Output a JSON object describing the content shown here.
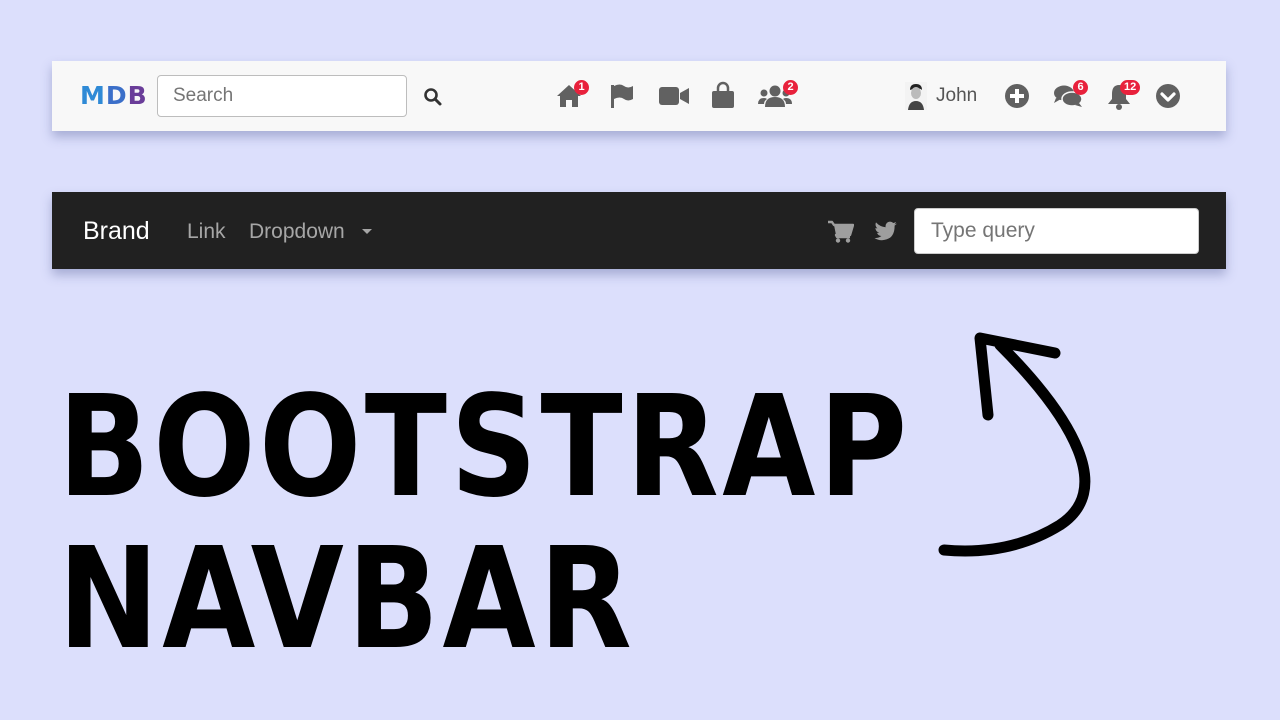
{
  "light_navbar": {
    "logo": {
      "m": "M",
      "d": "D",
      "b": "B"
    },
    "search": {
      "placeholder": "Search",
      "value": ""
    },
    "icons": [
      {
        "name": "home-icon",
        "badge": "1"
      },
      {
        "name": "flag-icon",
        "badge": null
      },
      {
        "name": "video-icon",
        "badge": null
      },
      {
        "name": "shopping-bag-icon",
        "badge": null
      },
      {
        "name": "users-icon",
        "badge": "2"
      }
    ],
    "user": {
      "name": "John"
    },
    "right_icons": [
      {
        "name": "plus-circle-icon",
        "badge": null
      },
      {
        "name": "comments-icon",
        "badge": "6"
      },
      {
        "name": "bell-icon",
        "badge": "12"
      },
      {
        "name": "chevron-circle-down-icon",
        "badge": null
      }
    ],
    "badges": {
      "home": "1",
      "users": "2",
      "comments": "6",
      "bell": "12"
    },
    "colors": {
      "badge": "#e8213c",
      "icon": "#616161"
    }
  },
  "dark_navbar": {
    "brand": "Brand",
    "links": {
      "link": "Link",
      "dropdown": "Dropdown"
    },
    "icons": [
      "cart-icon",
      "twitter-icon"
    ],
    "query": {
      "placeholder": "Type query",
      "value": ""
    },
    "colors": {
      "background": "#212121"
    }
  },
  "headline": {
    "line1": "BOOTSTRAP",
    "line2": "NAVBAR"
  }
}
